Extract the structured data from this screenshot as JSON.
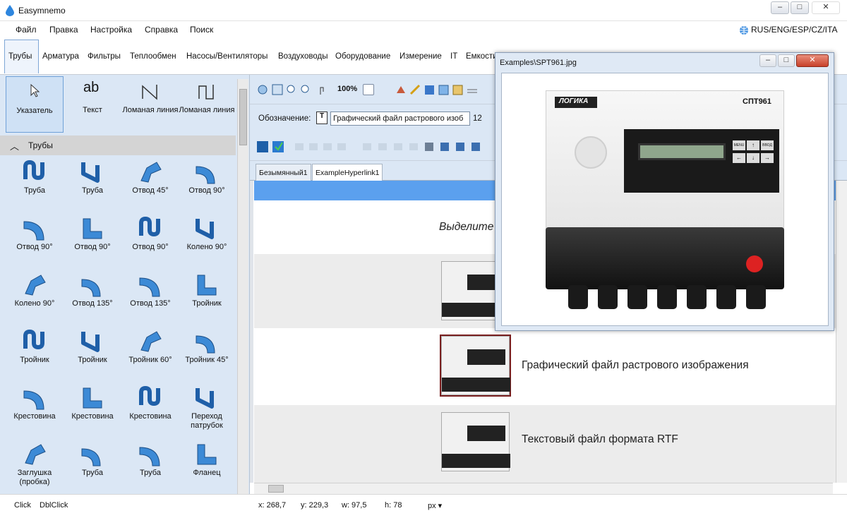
{
  "window": {
    "title": "Easymnemo",
    "min_icon": "minimize-icon",
    "max_icon": "maximize-icon",
    "close_icon": "close-icon"
  },
  "menu": {
    "items": [
      "Файл",
      "Правка",
      "Настройка",
      "Справка",
      "Поиск"
    ],
    "language": "RUS/ENG/ESP/CZ/ITA"
  },
  "category_tabs": [
    "Трубы",
    "Арматура",
    "Фильтры",
    "Теплообмен",
    "Насосы/Вентиляторы",
    "Воздуховоды",
    "Оборудование",
    "Измерение",
    "IT",
    "Емкости"
  ],
  "tools": [
    {
      "label": "Указатель"
    },
    {
      "label": "Текст",
      "glyph": "ab"
    },
    {
      "label": "Ломаная линия"
    },
    {
      "label": "Ломаная линия"
    }
  ],
  "group": {
    "title": "Трубы"
  },
  "palette": [
    [
      "Труба",
      "Труба",
      "Отвод 45°",
      "Отвод 90°"
    ],
    [
      "Отвод 90°",
      "Отвод 90°",
      "Отвод 90°",
      "Колено 90°"
    ],
    [
      "Колено 90°",
      "Отвод 135°",
      "Отвод 135°",
      "Тройник"
    ],
    [
      "Тройник",
      "Тройник",
      "Тройник 60°",
      "Тройник 45°"
    ],
    [
      "Крестовина",
      "Крестовина",
      "Крестовина",
      "Переход патрубок"
    ],
    [
      "Заглушка (пробка)",
      "Труба",
      "Труба",
      "Фланец"
    ]
  ],
  "toolbar": {
    "zoom": "100%",
    "designation_label": "Обозначение:",
    "designation_value": "Графический файл растрового изоб",
    "designation_num": "12"
  },
  "doc_tabs": [
    "Безымянный1",
    "ExampleHyperlink1"
  ],
  "canvas": {
    "heading": "Выделите",
    "row2": "Графический файл растрового изображения",
    "row3": "Текстовый файл формата RTF"
  },
  "image_window": {
    "title": "Examples\\SPT961.jpg",
    "brand": "ЛОГИКА",
    "model": "СПТ961",
    "keys": [
      "MENU",
      "↑",
      "ВВОД",
      "←",
      "↓",
      "→"
    ]
  },
  "status": {
    "click": "Click",
    "dblclick": "DblClick",
    "x": "x: 268,7",
    "y": "y: 229,3",
    "w": "w: 97,5",
    "h": "h: 78",
    "unit": "px ▾"
  },
  "colors": {
    "accent": "#5ba0ee",
    "pipe": "#2a6fb5",
    "palette_bg": "#dbe7f5"
  }
}
